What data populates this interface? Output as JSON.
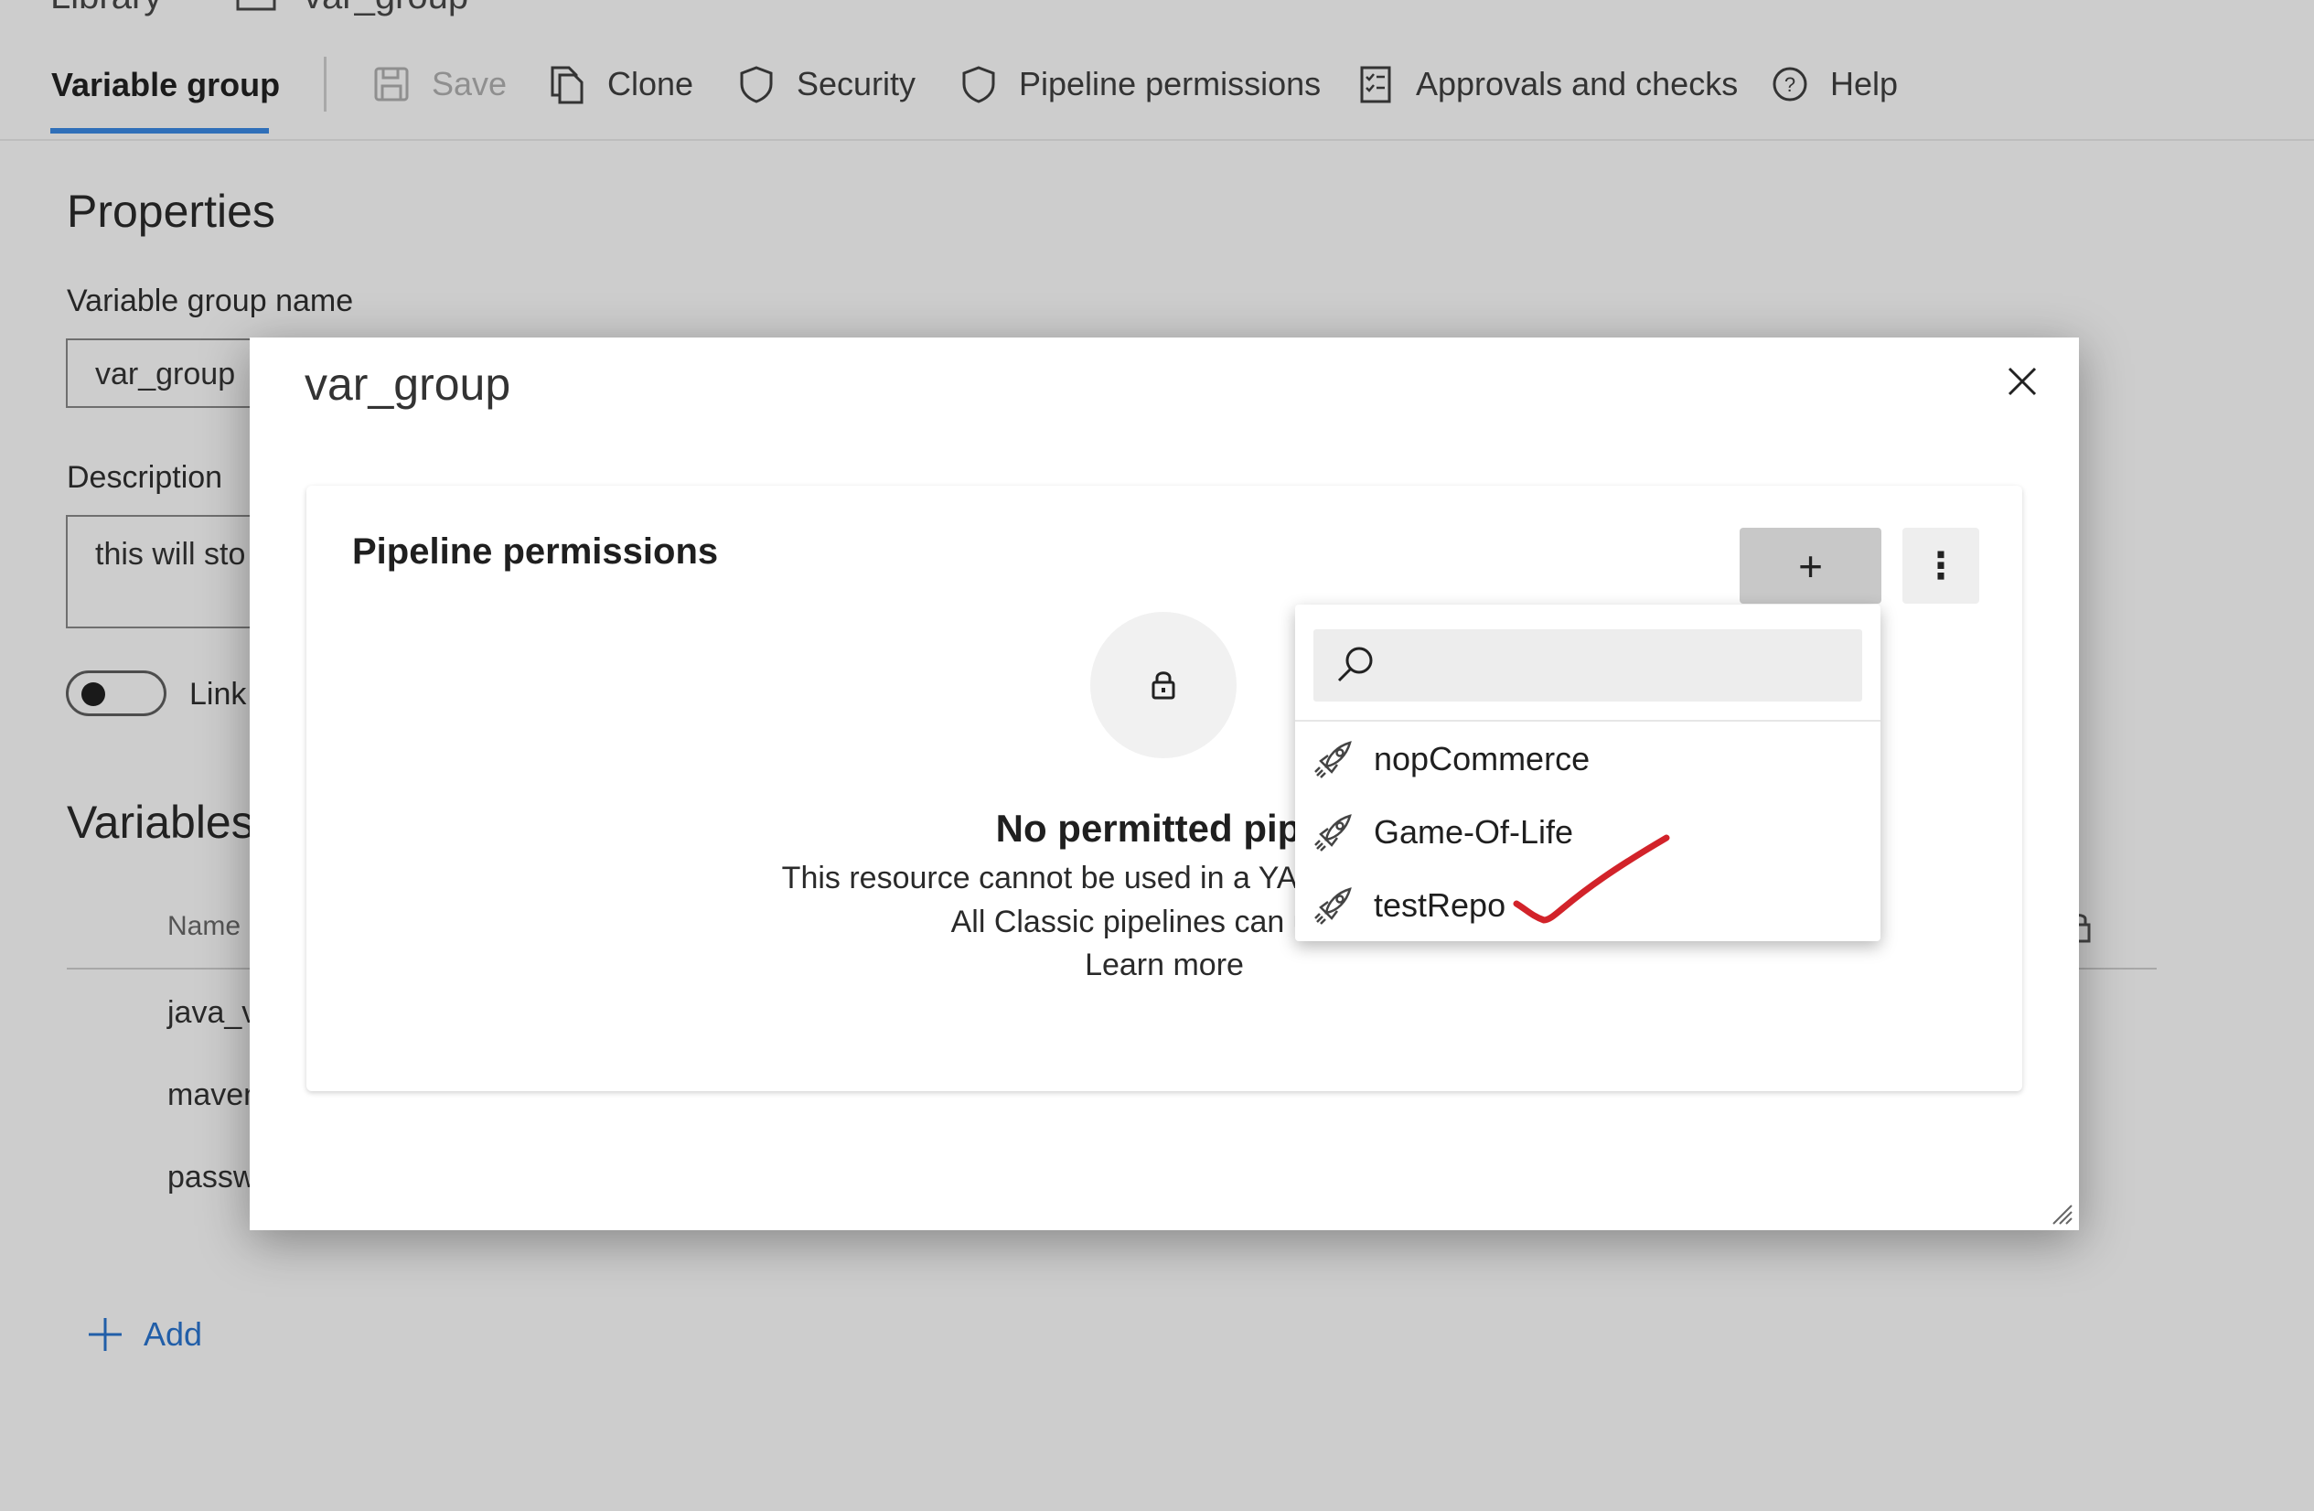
{
  "breadcrumb": {
    "root": "Library",
    "current": "var_group"
  },
  "toolbar": {
    "active_tab": "Variable group",
    "save": "Save",
    "clone": "Clone",
    "security": "Security",
    "pipeline_permissions": "Pipeline permissions",
    "approvals": "Approvals and checks",
    "help": "Help"
  },
  "properties": {
    "heading": "Properties",
    "name_label": "Variable group name",
    "name_value": "var_group",
    "description_label": "Description",
    "description_value": "this will sto",
    "link_label": "Link"
  },
  "variables": {
    "heading": "Variables",
    "name_column": "Name",
    "rows": [
      "java_v",
      "maven",
      "passw"
    ],
    "add_label": "Add"
  },
  "modal": {
    "title": "var_group",
    "card_title": "Pipeline permissions",
    "add_symbol": "+",
    "more_symbol": "⋮",
    "empty_title": "No permitted pipel",
    "empty_line1": "This resource cannot be used in a YAML pipeline until a",
    "empty_line2": "All Classic pipelines can use th",
    "learn_more": "Learn more"
  },
  "dropdown": {
    "search_placeholder": "",
    "items": [
      "nopCommerce",
      "Game-Of-Life",
      "testRepo"
    ]
  },
  "colors": {
    "accent": "#2f6fb9",
    "annotation_check": "#d2232a",
    "overlay_bg": "#cdcdcd",
    "link_blue": "#215ea8"
  }
}
